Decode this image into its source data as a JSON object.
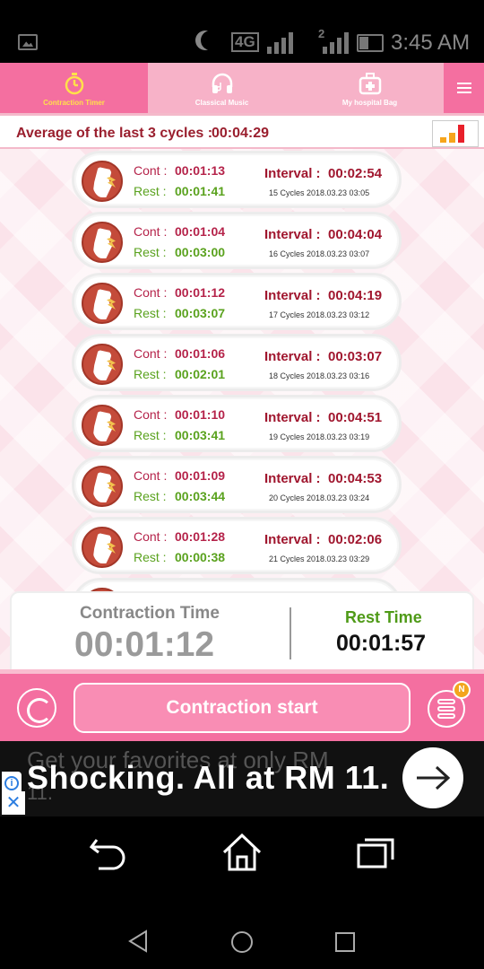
{
  "status_bar": {
    "network": "4G",
    "sim": "2",
    "time": "3:45 AM",
    "icons": [
      "gallery-icon",
      "moon-icon",
      "signal-icon",
      "battery-icon"
    ]
  },
  "tabs": [
    {
      "label": "Contraction Timer",
      "icon": "stopwatch-icon",
      "active": true
    },
    {
      "label": "Classical Music",
      "icon": "headphones-icon",
      "active": false
    },
    {
      "label": "My hospital Bag",
      "icon": "medical-bag-icon",
      "active": false
    }
  ],
  "average": {
    "label": "Average of the last 3 cycles :",
    "value": "00:04:29"
  },
  "cycles": [
    {
      "cont_label": "Cont :",
      "cont": "00:01:13",
      "rest_label": "Rest :",
      "rest": "00:01:41",
      "interval_label": "Interval :",
      "interval": "00:02:54",
      "meta": "15 Cycles   2018.03.23 03:05"
    },
    {
      "cont_label": "Cont :",
      "cont": "00:01:04",
      "rest_label": "Rest :",
      "rest": "00:03:00",
      "interval_label": "Interval :",
      "interval": "00:04:04",
      "meta": "16 Cycles   2018.03.23 03:07"
    },
    {
      "cont_label": "Cont :",
      "cont": "00:01:12",
      "rest_label": "Rest :",
      "rest": "00:03:07",
      "interval_label": "Interval :",
      "interval": "00:04:19",
      "meta": "17 Cycles   2018.03.23 03:12"
    },
    {
      "cont_label": "Cont :",
      "cont": "00:01:06",
      "rest_label": "Rest :",
      "rest": "00:02:01",
      "interval_label": "Interval :",
      "interval": "00:03:07",
      "meta": "18 Cycles   2018.03.23 03:16"
    },
    {
      "cont_label": "Cont :",
      "cont": "00:01:10",
      "rest_label": "Rest :",
      "rest": "00:03:41",
      "interval_label": "Interval :",
      "interval": "00:04:51",
      "meta": "19 Cycles   2018.03.23 03:19"
    },
    {
      "cont_label": "Cont :",
      "cont": "00:01:09",
      "rest_label": "Rest :",
      "rest": "00:03:44",
      "interval_label": "Interval :",
      "interval": "00:04:53",
      "meta": "20 Cycles   2018.03.23 03:24"
    },
    {
      "cont_label": "Cont :",
      "cont": "00:01:28",
      "rest_label": "Rest :",
      "rest": "00:00:38",
      "interval_label": "Interval :",
      "interval": "00:02:06",
      "meta": "21 Cycles   2018.03.23 03:29"
    },
    {
      "cont_label": "",
      "cont": "",
      "rest_label": "",
      "rest": "",
      "interval_label": "",
      "interval": "",
      "meta": ""
    }
  ],
  "timer": {
    "contraction_label": "Contraction Time",
    "contraction_value": "00:01:12",
    "rest_label": "Rest Time",
    "rest_value": "00:01:57"
  },
  "actions": {
    "start_label": "Contraction start",
    "badge": "N"
  },
  "ad": {
    "under_text": "Get your favorites at only RM",
    "under_text2": "11.",
    "headline": "Shocking. All at RM 11.",
    "info": "i",
    "close": "✕"
  },
  "colors": {
    "tab_active": "#f46fa0",
    "tab_bar": "#f7b2c8",
    "cont": "#b5234a",
    "rest": "#5aa21e",
    "interval": "#a0162e"
  }
}
